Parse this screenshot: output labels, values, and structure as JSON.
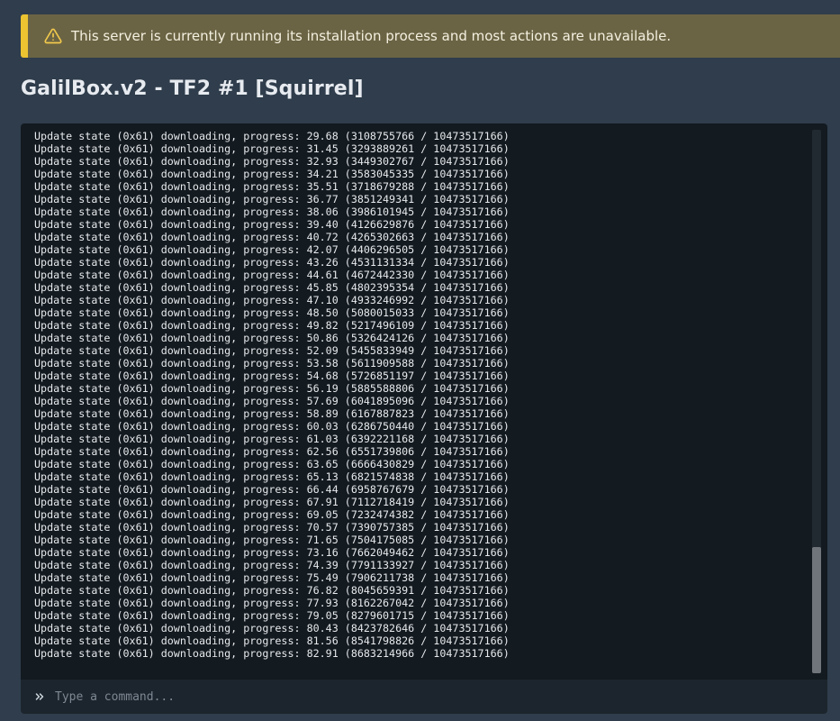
{
  "alert": {
    "icon": "warning-triangle-icon",
    "text": "This server is currently running its installation process and most actions are unavailable.",
    "accent_color": "#ecc331"
  },
  "page": {
    "title": "GalilBox.v2 - TF2 #1 [Squirrel]"
  },
  "console": {
    "lines": [
      "Update state (0x61) downloading, progress: 29.68 (3108755766 / 10473517166)",
      "Update state (0x61) downloading, progress: 31.45 (3293889261 / 10473517166)",
      "Update state (0x61) downloading, progress: 32.93 (3449302767 / 10473517166)",
      "Update state (0x61) downloading, progress: 34.21 (3583045335 / 10473517166)",
      "Update state (0x61) downloading, progress: 35.51 (3718679288 / 10473517166)",
      "Update state (0x61) downloading, progress: 36.77 (3851249341 / 10473517166)",
      "Update state (0x61) downloading, progress: 38.06 (3986101945 / 10473517166)",
      "Update state (0x61) downloading, progress: 39.40 (4126629876 / 10473517166)",
      "Update state (0x61) downloading, progress: 40.72 (4265302663 / 10473517166)",
      "Update state (0x61) downloading, progress: 42.07 (4406296505 / 10473517166)",
      "Update state (0x61) downloading, progress: 43.26 (4531131334 / 10473517166)",
      "Update state (0x61) downloading, progress: 44.61 (4672442330 / 10473517166)",
      "Update state (0x61) downloading, progress: 45.85 (4802395354 / 10473517166)",
      "Update state (0x61) downloading, progress: 47.10 (4933246992 / 10473517166)",
      "Update state (0x61) downloading, progress: 48.50 (5080015033 / 10473517166)",
      "Update state (0x61) downloading, progress: 49.82 (5217496109 / 10473517166)",
      "Update state (0x61) downloading, progress: 50.86 (5326424126 / 10473517166)",
      "Update state (0x61) downloading, progress: 52.09 (5455833949 / 10473517166)",
      "Update state (0x61) downloading, progress: 53.58 (5611909588 / 10473517166)",
      "Update state (0x61) downloading, progress: 54.68 (5726851197 / 10473517166)",
      "Update state (0x61) downloading, progress: 56.19 (5885588806 / 10473517166)",
      "Update state (0x61) downloading, progress: 57.69 (6041895096 / 10473517166)",
      "Update state (0x61) downloading, progress: 58.89 (6167887823 / 10473517166)",
      "Update state (0x61) downloading, progress: 60.03 (6286750440 / 10473517166)",
      "Update state (0x61) downloading, progress: 61.03 (6392221168 / 10473517166)",
      "Update state (0x61) downloading, progress: 62.56 (6551739806 / 10473517166)",
      "Update state (0x61) downloading, progress: 63.65 (6666430829 / 10473517166)",
      "Update state (0x61) downloading, progress: 65.13 (6821574838 / 10473517166)",
      "Update state (0x61) downloading, progress: 66.44 (6958767679 / 10473517166)",
      "Update state (0x61) downloading, progress: 67.91 (7112718419 / 10473517166)",
      "Update state (0x61) downloading, progress: 69.05 (7232474382 / 10473517166)",
      "Update state (0x61) downloading, progress: 70.57 (7390757385 / 10473517166)",
      "Update state (0x61) downloading, progress: 71.65 (7504175085 / 10473517166)",
      "Update state (0x61) downloading, progress: 73.16 (7662049462 / 10473517166)",
      "Update state (0x61) downloading, progress: 74.39 (7791133927 / 10473517166)",
      "Update state (0x61) downloading, progress: 75.49 (7906211738 / 10473517166)",
      "Update state (0x61) downloading, progress: 76.82 (8045659391 / 10473517166)",
      "Update state (0x61) downloading, progress: 77.93 (8162267042 / 10473517166)",
      "Update state (0x61) downloading, progress: 79.05 (8279601715 / 10473517166)",
      "Update state (0x61) downloading, progress: 80.43 (8423782646 / 10473517166)",
      "Update state (0x61) downloading, progress: 81.56 (8541798826 / 10473517166)",
      "Update state (0x61) downloading, progress: 82.91 (8683214966 / 10473517166)"
    ],
    "command": {
      "icon": "chevrons-right-icon",
      "placeholder": "Type a command...",
      "value": ""
    }
  }
}
